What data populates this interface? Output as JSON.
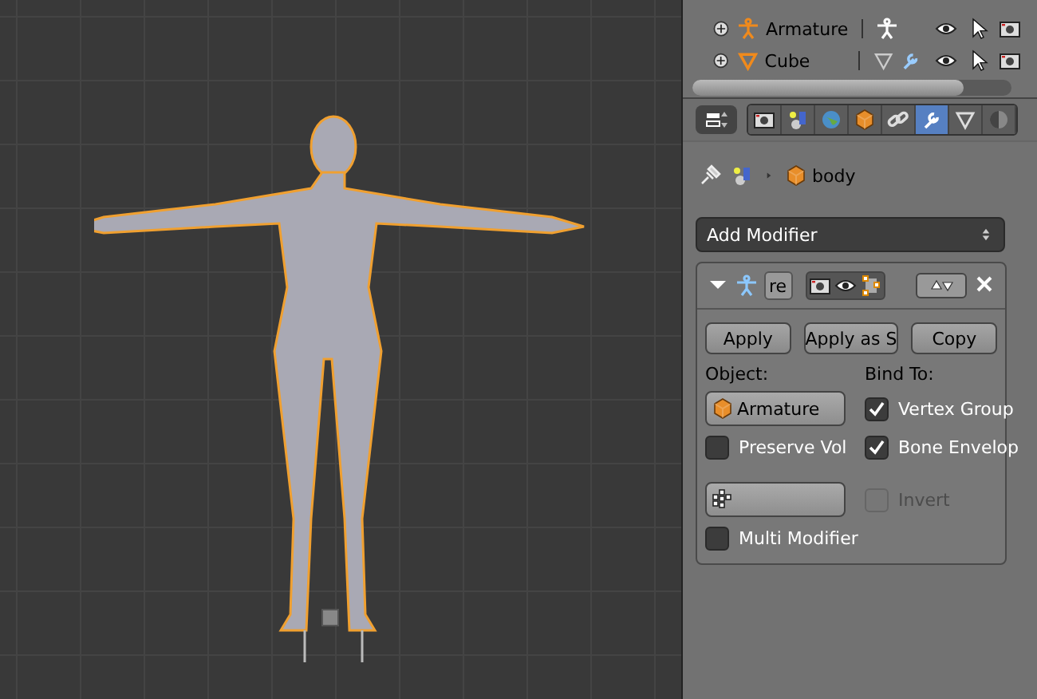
{
  "outliner": {
    "rows": [
      {
        "name": "Armature",
        "kind": "armature"
      },
      {
        "name": "Cube",
        "kind": "mesh"
      }
    ]
  },
  "properties_tabs": [
    {
      "kind": "render",
      "selected": false
    },
    {
      "kind": "scene",
      "selected": false
    },
    {
      "kind": "world",
      "selected": false
    },
    {
      "kind": "object",
      "selected": false
    },
    {
      "kind": "constraints",
      "selected": false
    },
    {
      "kind": "modifiers",
      "selected": true
    },
    {
      "kind": "data",
      "selected": false
    },
    {
      "kind": "material",
      "selected": false
    }
  ],
  "breadcrumb": {
    "object": "body"
  },
  "add_modifier": {
    "label": "Add Modifier"
  },
  "modifier": {
    "name": "re",
    "expanded": true,
    "buttons": [
      "Apply",
      "Apply as S",
      "Copy"
    ],
    "object_label": "Object:",
    "object_value": "Armature",
    "bind_label": "Bind To:",
    "options": [
      {
        "label": "Vertex Group",
        "checked": true,
        "disabled": false
      },
      {
        "label": "Bone Envelop",
        "checked": true,
        "disabled": false
      }
    ],
    "preserve_vol": {
      "label": "Preserve Vol",
      "checked": false,
      "disabled": false
    },
    "invert": {
      "label": "Invert",
      "checked": false,
      "disabled": true
    },
    "multi_modifier": {
      "label": "Multi Modifier",
      "checked": false,
      "disabled": false
    }
  }
}
